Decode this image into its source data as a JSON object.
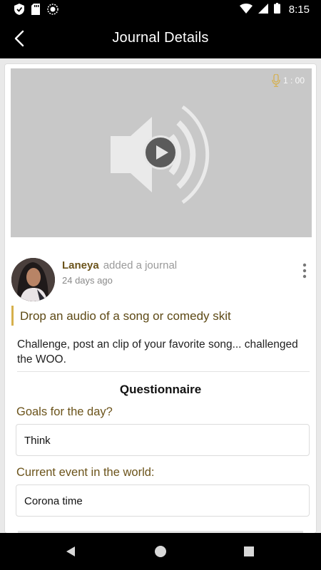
{
  "status_bar": {
    "time": "8:15",
    "icons": [
      "shield-icon",
      "sd-card-icon",
      "sync-icon",
      "wifi-icon",
      "cell-signal-icon",
      "battery-icon"
    ]
  },
  "app_bar": {
    "title": "Journal Details",
    "back_icon": "chevron-left-icon"
  },
  "media": {
    "duration": "1 : 00",
    "icons": [
      "microphone-icon",
      "speaker-icon",
      "play-icon"
    ]
  },
  "post": {
    "author": "Laneya",
    "action": "added a journal",
    "time_ago": "24 days ago",
    "title": "Drop an audio of a song or comedy skit",
    "body": "Challenge, post an clip of your favorite song... challenged the WOO."
  },
  "questionnaire": {
    "heading": "Questionnaire",
    "items": [
      {
        "question": "Goals for the day?",
        "answer": "Think"
      },
      {
        "question": "Current event in the world:",
        "answer": "Corona time"
      }
    ]
  },
  "colors": {
    "accent_gold": "#d6b04c",
    "label_brown": "#6b531a",
    "bar_black": "#000000"
  }
}
